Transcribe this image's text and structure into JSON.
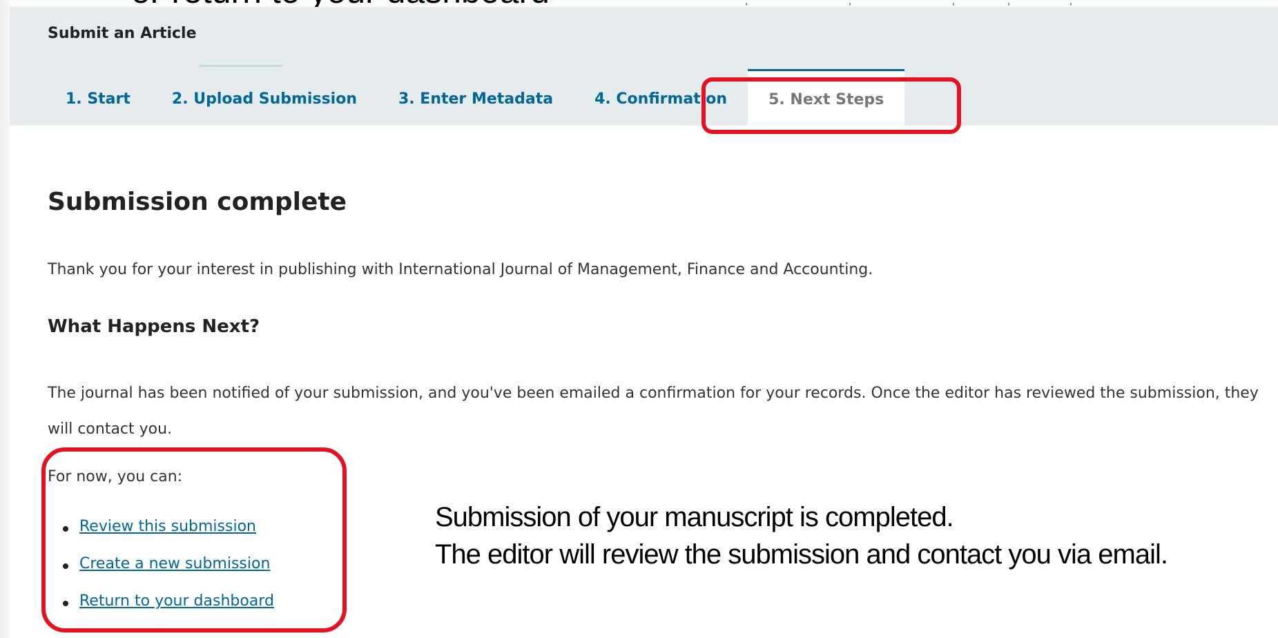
{
  "slide": {
    "clipped_heading": "or return to your dashboard"
  },
  "page": {
    "heading": "Submit an Article"
  },
  "tabs": [
    {
      "label": "1. Start"
    },
    {
      "label": "2. Upload Submission"
    },
    {
      "label": "3. Enter Metadata"
    },
    {
      "label": "4. Confirmation"
    },
    {
      "label": "5. Next Steps",
      "active": true
    }
  ],
  "main": {
    "title": "Submission complete",
    "thanks": "Thank you for your interest in publishing with International Journal of Management, Finance and Accounting.",
    "next_heading": "What Happens Next?",
    "notified_text": "The journal has been notified of your submission, and you've been emailed a confirmation for your records. Once the editor has reviewed the submission, they will contact you.",
    "for_now": "For now, you can:",
    "links": [
      {
        "label": "Review this submission"
      },
      {
        "label": "Create a new submission"
      },
      {
        "label": "Return to your dashboard"
      }
    ]
  },
  "annotation": {
    "line1": "Submission of your manuscript is completed.",
    "line2": "The editor will review the submission and contact you via email."
  },
  "colors": {
    "link": "#006798",
    "highlight": "#e4111e",
    "header_bg": "#e6ecee"
  }
}
